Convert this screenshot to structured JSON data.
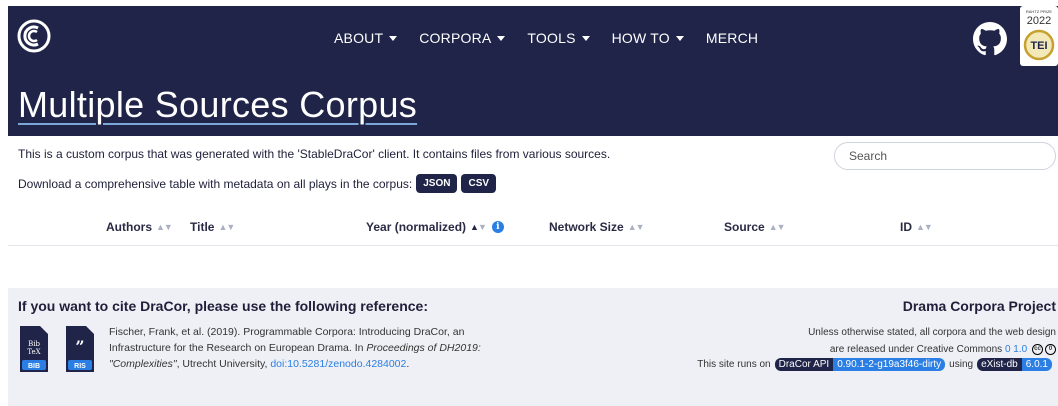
{
  "nav": {
    "items": [
      {
        "label": "ABOUT",
        "dropdown": true
      },
      {
        "label": "CORPORA",
        "dropdown": true
      },
      {
        "label": "TOOLS",
        "dropdown": true
      },
      {
        "label": "HOW TO",
        "dropdown": true
      },
      {
        "label": "MERCH",
        "dropdown": false
      }
    ],
    "badge": {
      "top": "RAHTZ PRIZE",
      "year": "2022",
      "name": "TEI"
    }
  },
  "page": {
    "title": "Multiple Sources Corpus",
    "description": "This is a custom corpus that was generated with the 'StableDraCor' client. It contains files from various sources.",
    "download_text": "Download a comprehensive table with metadata on all plays in the corpus:",
    "json_label": "JSON",
    "csv_label": "CSV"
  },
  "search": {
    "placeholder": "Search"
  },
  "table": {
    "columns": [
      "Authors",
      "Title",
      "Year (normalized)",
      "Network Size",
      "Source",
      "ID"
    ]
  },
  "footer": {
    "cite_heading": "If you want to cite DraCor, please use the following reference:",
    "bib_label": "BIB",
    "ris_label": "RIS",
    "cite_part1": "Fischer, Frank, et al. (2019). Programmable Corpora: Introducing DraCor, an Infrastructure for the Research on European Drama. In ",
    "cite_italic": "Proceedings of DH2019: \"Complexities\"",
    "cite_part2": ", Utrecht University, ",
    "cite_doi": "doi:10.5281/zenodo.4284002",
    "cite_end": ".",
    "project_title": "Drama Corpora Project",
    "license_line1": "Unless otherwise stated, all corpora and the web design",
    "license_line2": "are released under Creative Commons",
    "license_link": "0 1.0",
    "cc_symbol": "cc",
    "zero_symbol": "0",
    "runs_text": "This site runs on",
    "api_label": "DraCor API",
    "api_version": "0.90.1-2-g19a3f46-dirty",
    "using_text": "using",
    "db_label": "eXist-db",
    "db_version": "6.0.1"
  },
  "colors": {
    "navy": "#1f2448",
    "accent_blue": "#2b7ee3",
    "footer_bg": "#eef0f5"
  }
}
